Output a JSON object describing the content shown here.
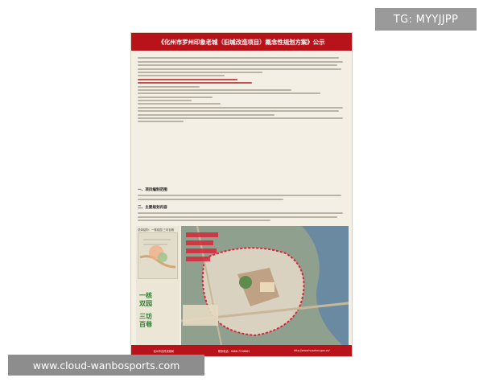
{
  "tg_badge": "TG: MYYJJPP",
  "poster": {
    "title": "《化州市罗州印象老城（旧城改造项目）概念性规划方案》公示",
    "section1_heading": "一、项目编制范围",
    "section2_heading": "二、主要规划内容",
    "map_caption": "总体结构：一核双园 三坊百巷",
    "label_1": "一核\n双园",
    "label_2": "三坊\n百巷",
    "footer": [
      "化州市自然资源局",
      "联系电话：0668-7316663",
      "http://www.huazhou.gov.cn/"
    ]
  },
  "watermark": "www.cloud-wanbosports.com",
  "colors": {
    "poster_red": "#b8121a",
    "poster_bg": "#f3efe4",
    "badge_grey": "#9a9a9a",
    "label_green": "#2f7d35"
  }
}
